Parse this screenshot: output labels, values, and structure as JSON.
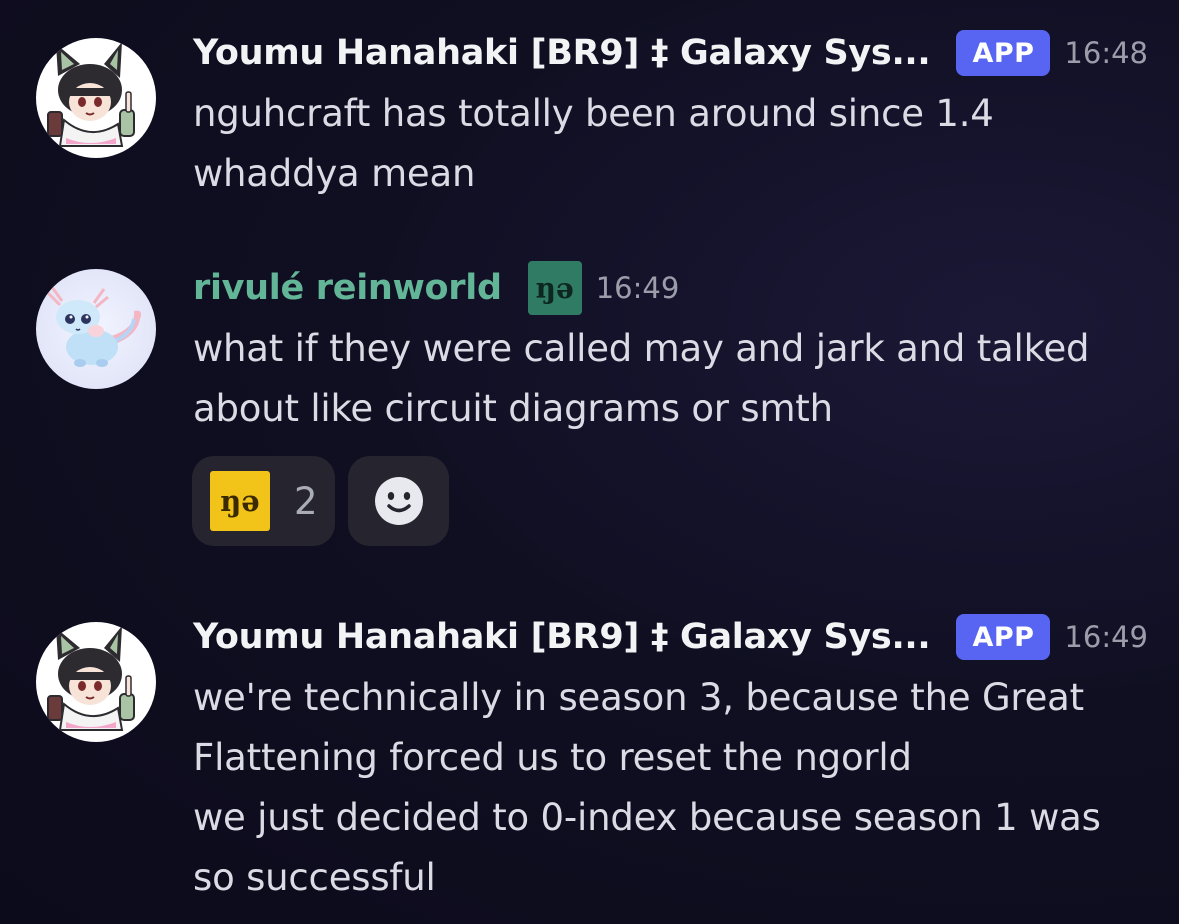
{
  "messages": [
    {
      "username": "Youmu Hanahaki [BR9] ‡ Galaxy Sys...",
      "badge": "APP",
      "timestamp": "16:48",
      "lines": [
        "nguhcraft has totally been around since 1.4",
        "whaddya mean"
      ]
    },
    {
      "username": "rivulé reinworld",
      "role_icon_text": "ŋə",
      "timestamp": "16:49",
      "lines": [
        "what if they were called may and jark and talked",
        "about like circuit diagrams or smth"
      ],
      "reactions": [
        {
          "emoji_text": "ŋə",
          "count": "2"
        },
        {
          "icon": "add-reaction-smiley-icon"
        }
      ]
    },
    {
      "username": "Youmu Hanahaki [BR9] ‡ Galaxy Sys...",
      "badge": "APP",
      "timestamp": "16:49",
      "lines": [
        "we're technically in season 3, because the Great",
        "Flattening forced us to reset the ngorld",
        "we just decided to 0-index because season 1 was",
        "so successful"
      ]
    }
  ],
  "colors": {
    "background": "#100f22",
    "app_badge": "#5865f2",
    "username_green": "#62b597",
    "role_icon_bg": "#2f7b63",
    "reaction_emoji_bg": "#f2c419",
    "reaction_pill": "#26252f"
  }
}
